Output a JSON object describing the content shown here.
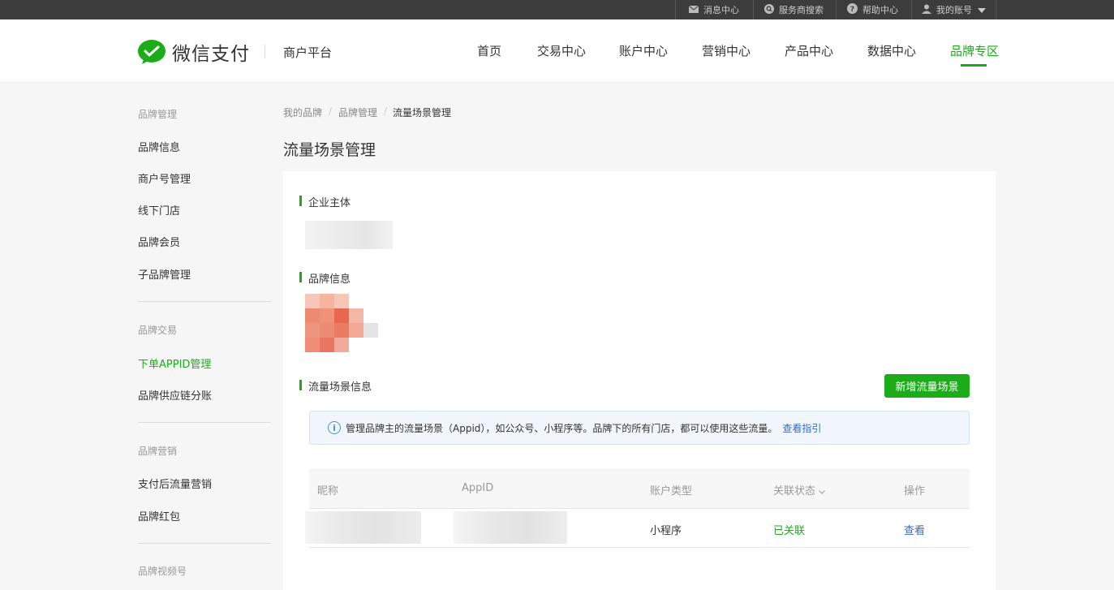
{
  "topbar": {
    "messages": "消息中心",
    "provider_search": "服务商搜索",
    "help": "帮助中心",
    "account": "我的账号"
  },
  "header": {
    "logo_text": "微信支付",
    "platform": "商户平台",
    "nav": [
      "首页",
      "交易中心",
      "账户中心",
      "营销中心",
      "产品中心",
      "数据中心",
      "品牌专区"
    ],
    "active_nav": "品牌专区"
  },
  "sidebar": {
    "groups": [
      {
        "title": "品牌管理",
        "items": [
          "品牌信息",
          "商户号管理",
          "线下门店",
          "品牌会员",
          "子品牌管理"
        ]
      },
      {
        "title": "品牌交易",
        "items": [
          "下单APPID管理",
          "品牌供应链分账"
        ]
      },
      {
        "title": "品牌营销",
        "items": [
          "支付后流量营销",
          "品牌红包"
        ]
      },
      {
        "title": "品牌视频号",
        "items": []
      }
    ],
    "active_item": "下单APPID管理"
  },
  "breadcrumb": [
    "我的品牌",
    "品牌管理",
    "流量场景管理"
  ],
  "page_title": "流量场景管理",
  "sections": {
    "entity": "企业主体",
    "brand_info": "品牌信息",
    "traffic": "流量场景信息"
  },
  "add_button": "新增流量场景",
  "notice": {
    "text": "管理品牌主的流量场景（Appid），如公众号、小程序等。品牌下的所有门店，都可以使用这些流量。",
    "link": "查看指引"
  },
  "table": {
    "columns": [
      "昵称",
      "AppID",
      "账户类型",
      "关联状态",
      "操作"
    ],
    "rows": [
      {
        "nickname": "",
        "appid": "",
        "type": "小程序",
        "status": "已关联",
        "action": "查看"
      }
    ]
  },
  "colors": {
    "accent": "#1aad19",
    "link": "#3c6bb8",
    "topbar": "#3c3c3c"
  }
}
